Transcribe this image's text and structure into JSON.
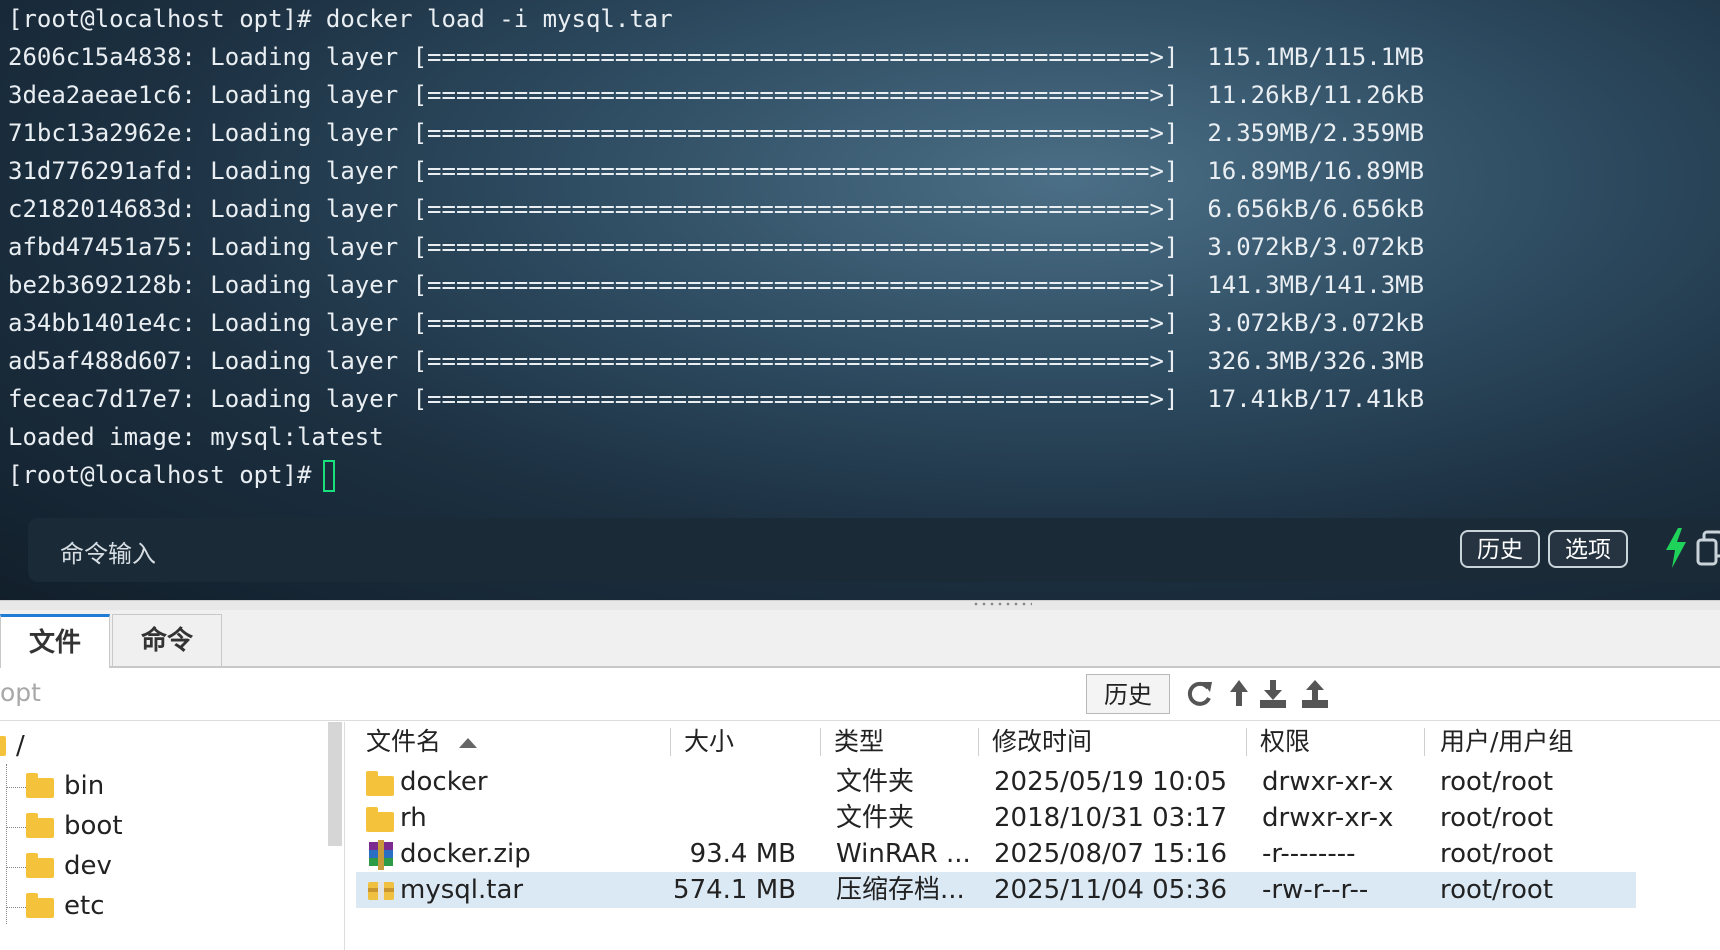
{
  "terminal": {
    "prompt_command": "[root@localhost opt]# docker load -i mysql.tar",
    "layers": [
      {
        "id": "2606c15a4838:",
        "label": "Loading layer",
        "bar": "[==================================================>]",
        "size": "115.1MB/115.1MB"
      },
      {
        "id": "3dea2aeae1c6:",
        "label": "Loading layer",
        "bar": "[==================================================>]",
        "size": "11.26kB/11.26kB"
      },
      {
        "id": "71bc13a2962e:",
        "label": "Loading layer",
        "bar": "[==================================================>]",
        "size": "2.359MB/2.359MB"
      },
      {
        "id": "31d776291afd:",
        "label": "Loading layer",
        "bar": "[==================================================>]",
        "size": "16.89MB/16.89MB"
      },
      {
        "id": "c2182014683d:",
        "label": "Loading layer",
        "bar": "[==================================================>]",
        "size": "6.656kB/6.656kB"
      },
      {
        "id": "afbd47451a75:",
        "label": "Loading layer",
        "bar": "[==================================================>]",
        "size": "3.072kB/3.072kB"
      },
      {
        "id": "be2b3692128b:",
        "label": "Loading layer",
        "bar": "[==================================================>]",
        "size": "141.3MB/141.3MB"
      },
      {
        "id": "a34bb1401e4c:",
        "label": "Loading layer",
        "bar": "[==================================================>]",
        "size": "3.072kB/3.072kB"
      },
      {
        "id": "ad5af488d607:",
        "label": "Loading layer",
        "bar": "[==================================================>]",
        "size": "326.3MB/326.3MB"
      },
      {
        "id": "feceac7d17e7:",
        "label": "Loading layer",
        "bar": "[==================================================>]",
        "size": "17.41kB/17.41kB"
      }
    ],
    "loaded_line": "Loaded image: mysql:latest",
    "prompt": "[root@localhost opt]#"
  },
  "command_bar": {
    "label": "命令输入",
    "history_label": "历史",
    "options_label": "选项",
    "bolt_color": "#1fd35a"
  },
  "tabs": {
    "files": "文件",
    "commands": "命令"
  },
  "path_bar": {
    "path": "opt",
    "history_label": "历史"
  },
  "tree": {
    "root": "/",
    "items": [
      "bin",
      "boot",
      "dev",
      "etc"
    ]
  },
  "file_list": {
    "columns": {
      "name": "文件名",
      "size": "大小",
      "type": "类型",
      "mtime": "修改时间",
      "perm": "权限",
      "owner": "用户/用户组"
    },
    "rows": [
      {
        "name": "docker",
        "size": "",
        "type": "文件夹",
        "mtime": "2025/05/19 10:05",
        "perm": "drwxr-xr-x",
        "owner": "root/root",
        "icon": "folder-icon"
      },
      {
        "name": "rh",
        "size": "",
        "type": "文件夹",
        "mtime": "2018/10/31 03:17",
        "perm": "drwxr-xr-x",
        "owner": "root/root",
        "icon": "folder-icon"
      },
      {
        "name": "docker.zip",
        "size": "93.4 MB",
        "type": "WinRAR ...",
        "mtime": "2025/08/07 15:16",
        "perm": "-r--------",
        "owner": "root/root",
        "icon": "winrar-archive-icon"
      },
      {
        "name": "mysql.tar",
        "size": "574.1 MB",
        "type": "压缩存档...",
        "mtime": "2025/11/04 05:36",
        "perm": "-rw-r--r--",
        "owner": "root/root",
        "icon": "tar-archive-icon"
      }
    ]
  }
}
